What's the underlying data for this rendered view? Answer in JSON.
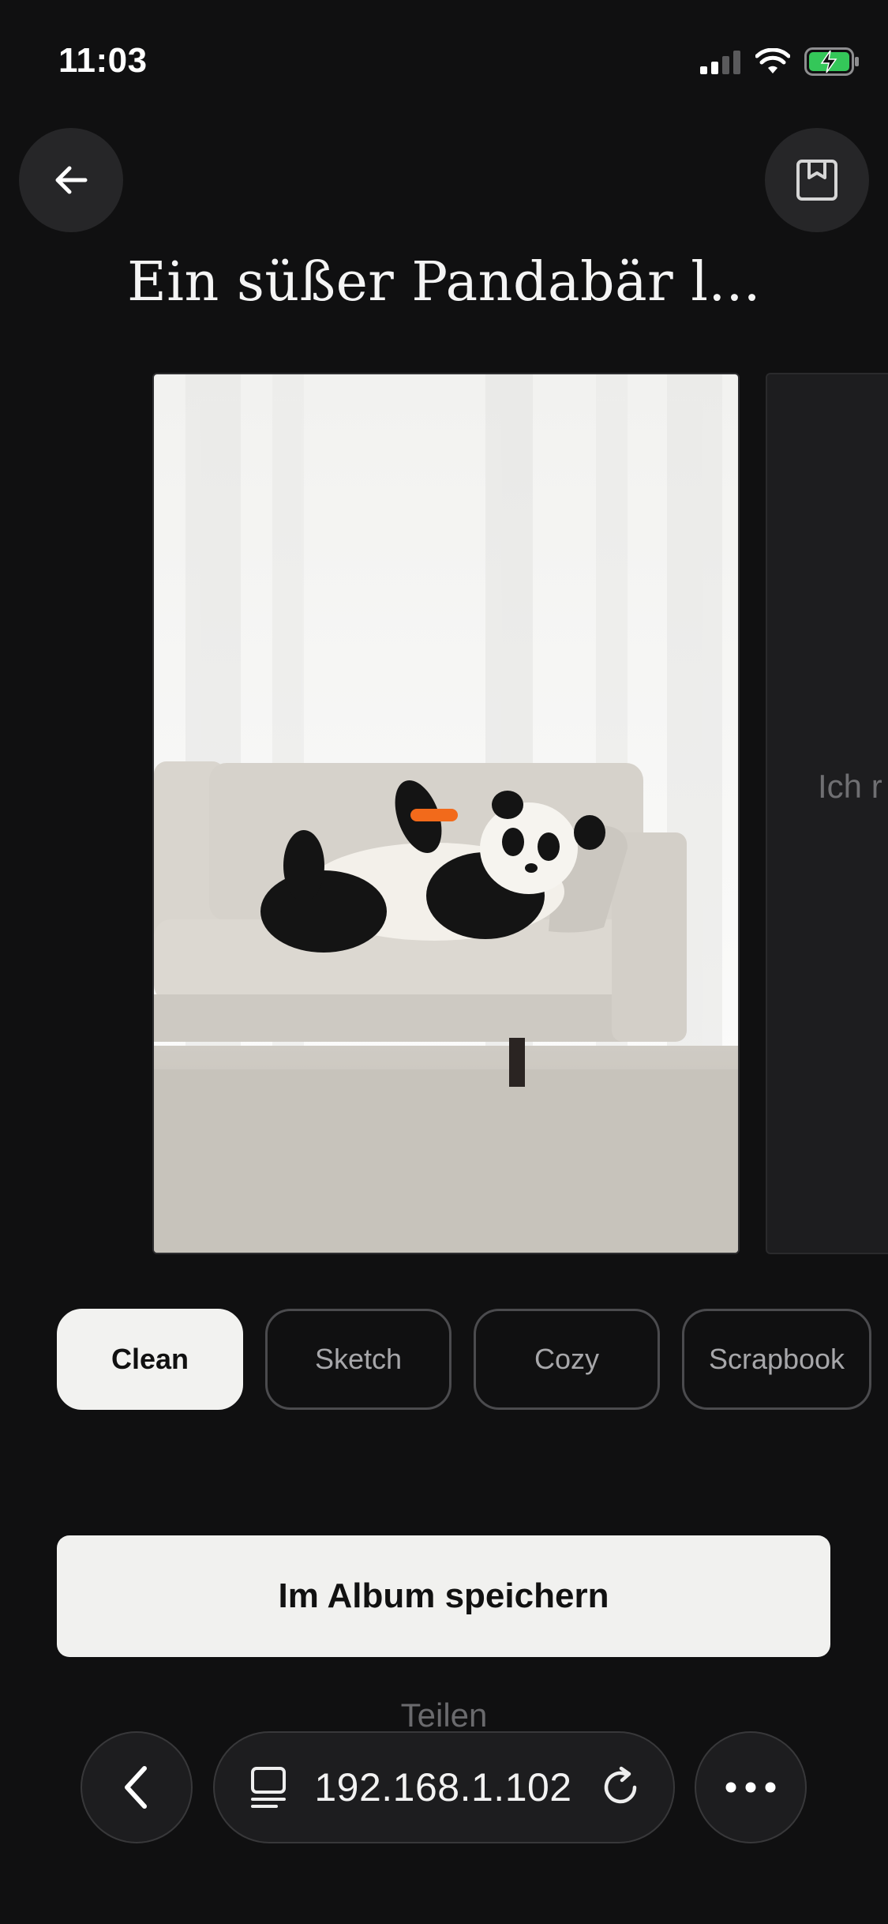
{
  "status_bar": {
    "time": "11:03",
    "icons": [
      "signal-icon",
      "wifi-icon",
      "battery-charging-icon"
    ],
    "battery_color": "#34c759"
  },
  "header": {
    "back_icon": "arrow-left-icon",
    "save_icon": "bookmark-icon",
    "title": "Ein süßer Pandabär l..."
  },
  "carousel": {
    "main_image": "panda-on-sofa-image",
    "next_preview_text": "Ich r"
  },
  "styles": {
    "chips": [
      {
        "label": "Clean",
        "selected": true
      },
      {
        "label": "Sketch",
        "selected": false
      },
      {
        "label": "Cozy",
        "selected": false
      },
      {
        "label": "Scrapbook",
        "selected": false
      }
    ]
  },
  "actions": {
    "save_label": "Im Album speichern",
    "share_label": "Teilen"
  },
  "browser_bar": {
    "back_icon": "chevron-left-icon",
    "site_icon": "server-icon",
    "url": "192.168.1.102",
    "reload_icon": "reload-icon",
    "more_icon": "more-icon"
  }
}
